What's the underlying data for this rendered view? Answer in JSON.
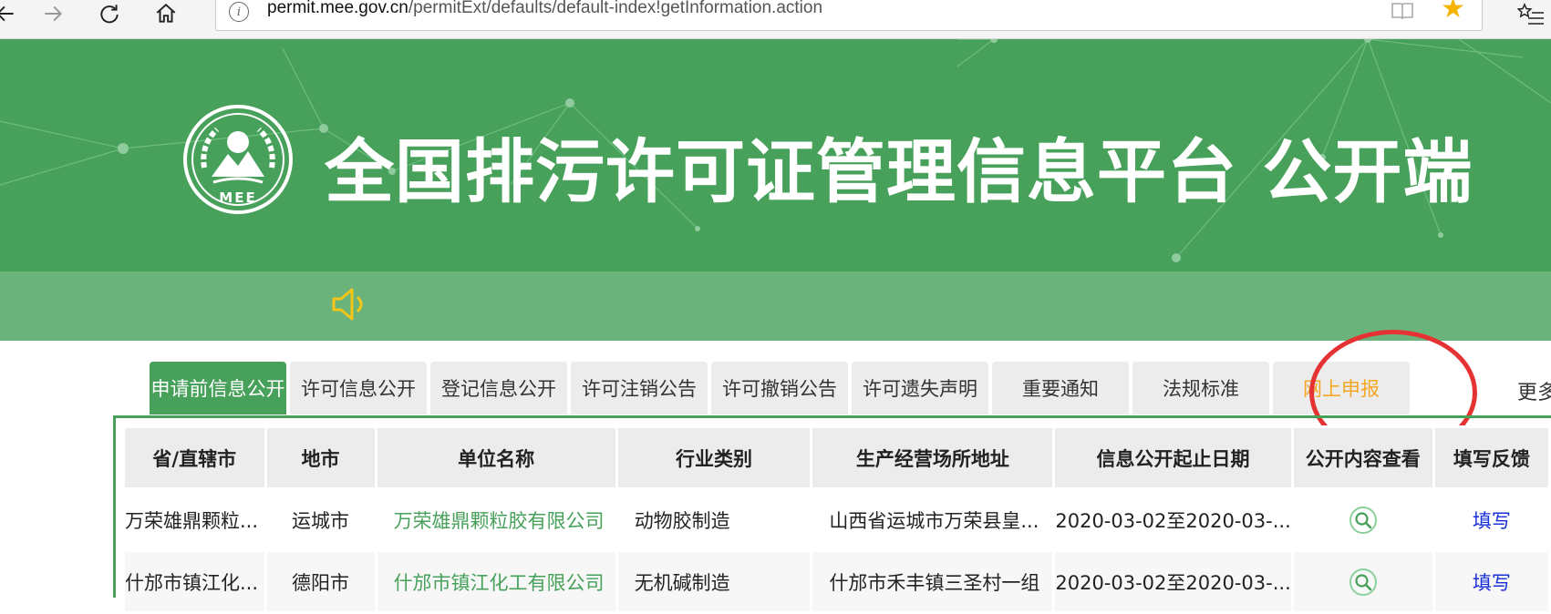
{
  "browser": {
    "url_host": "permit.mee.gov.cn",
    "url_path": "/permitExt/defaults/default-index!getInformation.action"
  },
  "header": {
    "title": "全国排污许可证管理信息平台  公开端",
    "logo_text": "MEE"
  },
  "tabs": [
    {
      "label": "申请前信息公开",
      "active": true
    },
    {
      "label": "许可信息公开"
    },
    {
      "label": "登记信息公开"
    },
    {
      "label": "许可注销公告"
    },
    {
      "label": "许可撤销公告"
    },
    {
      "label": "许可遗失声明"
    },
    {
      "label": "重要通知"
    },
    {
      "label": "法规标准"
    },
    {
      "label": "网上申报"
    }
  ],
  "more_label": "更多",
  "table": {
    "headers": [
      "省/直辖市",
      "地市",
      "单位名称",
      "行业类别",
      "生产经营场所地址",
      "信息公开起止日期",
      "公开内容查看",
      "填写反馈"
    ],
    "rows": [
      [
        "万荣雄鼎颗粒...",
        "运城市",
        "万荣雄鼎颗粒胶有限公司",
        "动物胶制造",
        "山西省运城市万荣县皇...",
        "2020-03-02至2020-03-...",
        "",
        "填写"
      ],
      [
        "什邡市镇江化...",
        "德阳市",
        "什邡市镇江化工有限公司",
        "无机碱制造",
        "什邡市禾丰镇三圣村一组",
        "2020-03-02至2020-03-...",
        "",
        "填写"
      ]
    ]
  },
  "colors": {
    "brand_green": "#47a15a",
    "notice_green": "#6ab37a",
    "highlight_red": "#e53333",
    "online_orange": "#f5a623",
    "link_blue": "#1a2fd8"
  }
}
